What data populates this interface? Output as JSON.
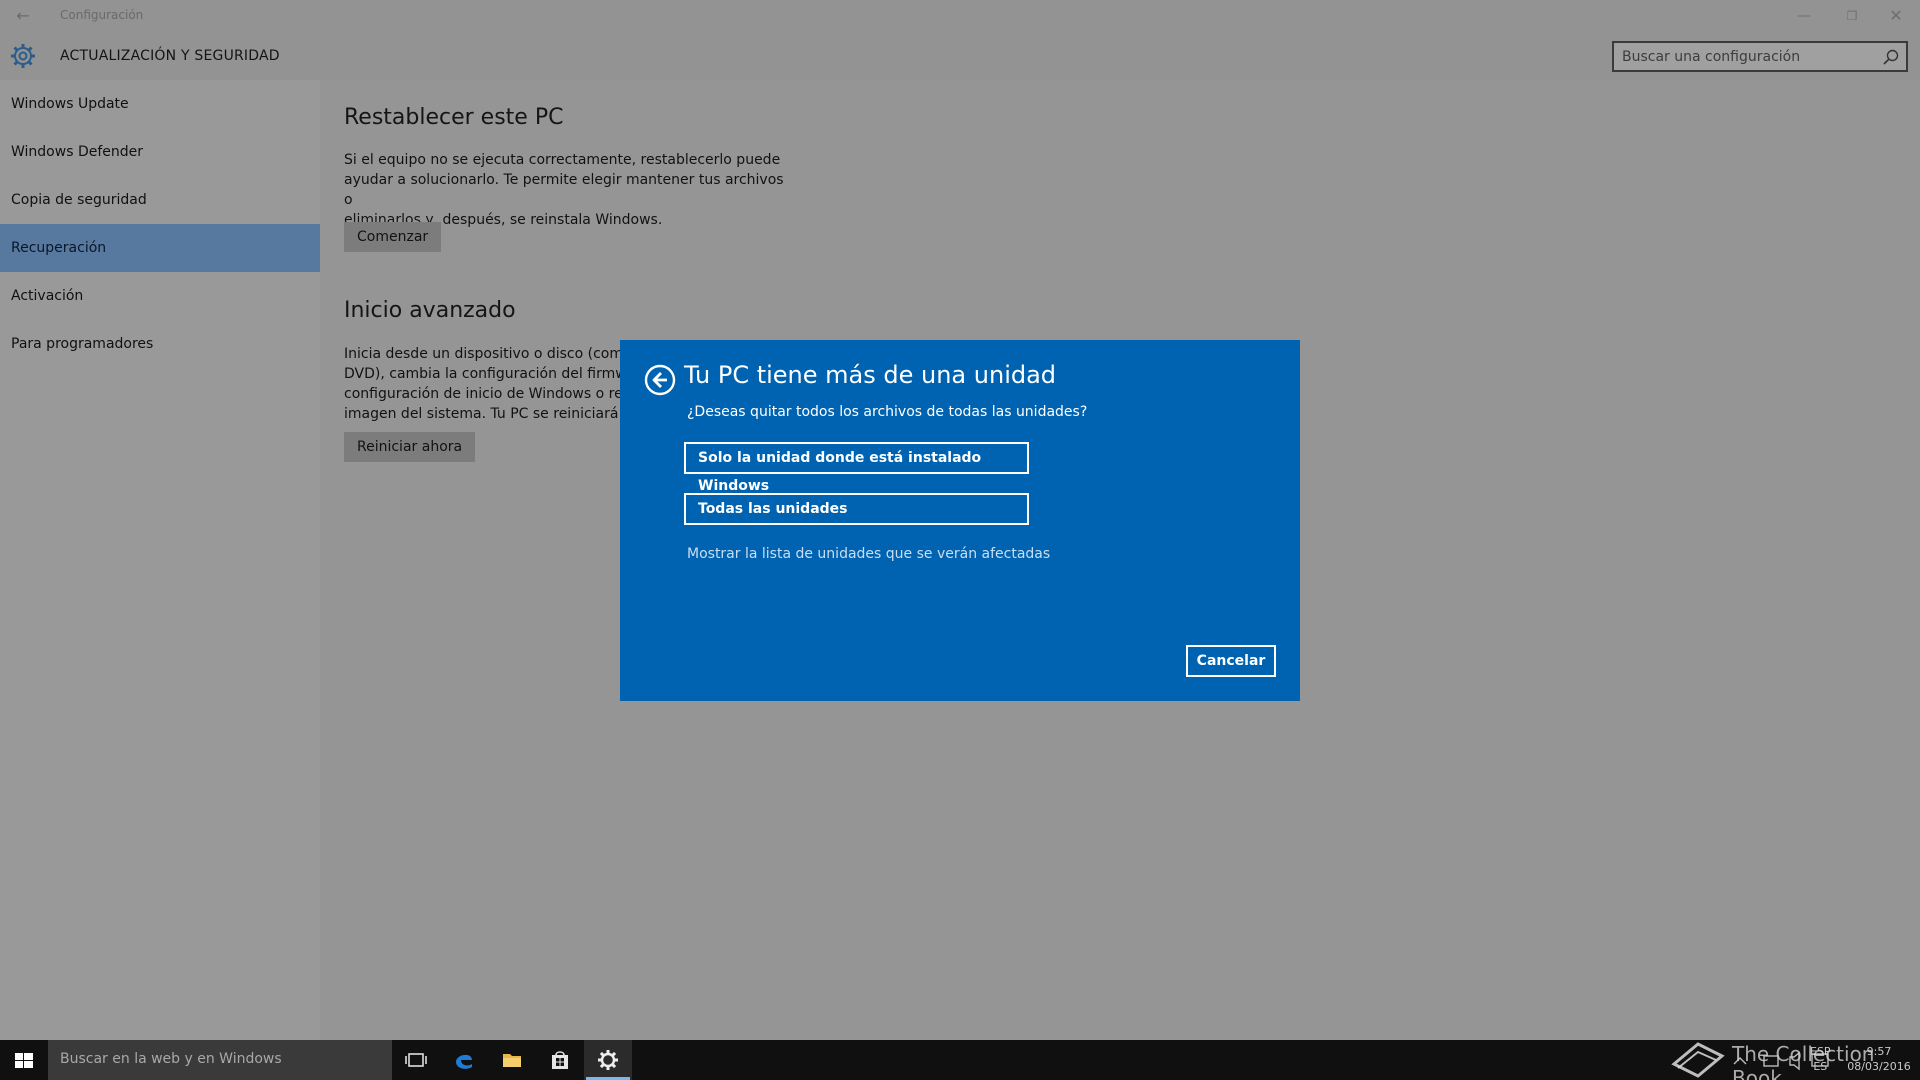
{
  "window": {
    "title": "Configuración"
  },
  "header": {
    "section_title": "ACTUALIZACIÓN Y SEGURIDAD",
    "search_placeholder": "Buscar una configuración"
  },
  "sidebar": {
    "items": [
      {
        "label": "Windows Update",
        "selected": false
      },
      {
        "label": "Windows Defender",
        "selected": false
      },
      {
        "label": "Copia de seguridad",
        "selected": false
      },
      {
        "label": "Recuperación",
        "selected": true
      },
      {
        "label": "Activación",
        "selected": false
      },
      {
        "label": "Para programadores",
        "selected": false
      }
    ]
  },
  "main": {
    "reset": {
      "heading": "Restablecer este PC",
      "lines": [
        "Si el equipo no se ejecuta correctamente, restablecerlo puede",
        "ayudar a solucionarlo. Te permite elegir mantener tus archivos o",
        "eliminarlos y, después, se reinstala Windows."
      ],
      "button": "Comenzar"
    },
    "advanced": {
      "heading": "Inicio avanzado",
      "lines": [
        "Inicia desde un dispositivo o disco (como",
        "DVD), cambia la configuración del firmwa",
        "configuración de inicio de Windows o rest",
        "imagen del sistema. Tu PC se reiniciará."
      ],
      "button": "Reiniciar ahora"
    }
  },
  "dialog": {
    "title": "Tu PC tiene más de una unidad",
    "question": "¿Deseas quitar todos los archivos de todas las unidades?",
    "option1": "Solo la unidad donde está instalado Windows",
    "option2": "Todas las unidades",
    "link": "Mostrar la lista de unidades que se verán afectadas",
    "cancel": "Cancelar"
  },
  "taskbar": {
    "search_placeholder": "Buscar en la web y en Windows",
    "lang": [
      "ESP",
      "ES"
    ],
    "time": "9:57",
    "date": "08/03/2016"
  },
  "watermark": {
    "text": "The Collection Book"
  },
  "colors": {
    "dialog_bg": "#0063b1",
    "selected_nav": "#57789f",
    "taskbar": "#101010"
  }
}
